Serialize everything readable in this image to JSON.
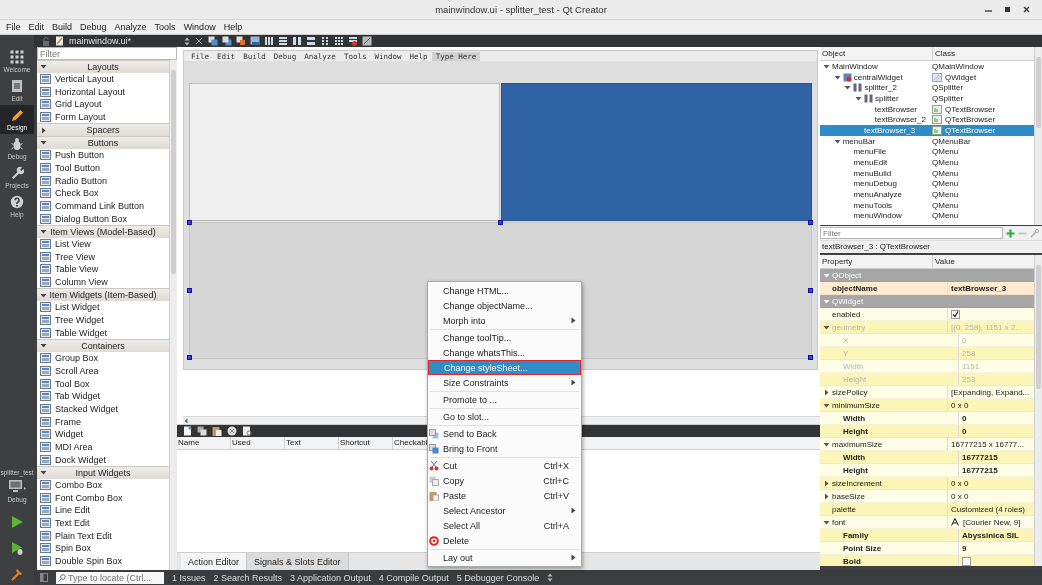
{
  "window": {
    "title": "mainwindow.ui - splitter_test - Qt Creator"
  },
  "menu_bar": [
    "File",
    "Edit",
    "Build",
    "Debug",
    "Analyze",
    "Tools",
    "Window",
    "Help"
  ],
  "mode_bar": {
    "modes": [
      {
        "label": "Welcome",
        "kind": "welcome",
        "selected": false
      },
      {
        "label": "Edit",
        "kind": "edit",
        "selected": false
      },
      {
        "label": "Design",
        "kind": "design",
        "selected": true
      },
      {
        "label": "Debug",
        "kind": "debug",
        "selected": false
      },
      {
        "label": "Projects",
        "kind": "projects",
        "selected": false
      },
      {
        "label": "Help",
        "kind": "help",
        "selected": false
      }
    ],
    "target": {
      "project": "splitter_test",
      "build": "Debug"
    }
  },
  "editor_toolbar": {
    "document": "mainwindow.ui*"
  },
  "widget_box": {
    "filter_placeholder": "Filter",
    "categories": [
      {
        "name": "Layouts",
        "expanded": true,
        "items": [
          "Vertical Layout",
          "Horizontal Layout",
          "Grid Layout",
          "Form Layout"
        ]
      },
      {
        "name": "Spacers",
        "expanded": false
      },
      {
        "name": "Buttons",
        "expanded": true,
        "items": [
          "Push Button",
          "Tool Button",
          "Radio Button",
          "Check Box",
          "Command Link Button",
          "Dialog Button Box"
        ]
      },
      {
        "name": "Item Views (Model-Based)",
        "expanded": true,
        "items": [
          "List View",
          "Tree View",
          "Table View",
          "Column View"
        ]
      },
      {
        "name": "Item Widgets (Item-Based)",
        "expanded": true,
        "items": [
          "List Widget",
          "Tree Widget",
          "Table Widget"
        ]
      },
      {
        "name": "Containers",
        "expanded": true,
        "items": [
          "Group Box",
          "Scroll Area",
          "Tool Box",
          "Tab Widget",
          "Stacked Widget",
          "Frame",
          "Widget",
          "MDI Area",
          "Dock Widget"
        ]
      },
      {
        "name": "Input Widgets",
        "expanded": true,
        "items": [
          "Combo Box",
          "Font Combo Box",
          "Line Edit",
          "Text Edit",
          "Plain Text Edit",
          "Spin Box",
          "Double Spin Box"
        ]
      }
    ]
  },
  "form": {
    "menu": [
      "File",
      "Edit",
      "Build",
      "Debug",
      "Analyze",
      "Tools",
      "Window",
      "Help"
    ],
    "add_menu_hint": "Type Here"
  },
  "action_editor": {
    "columns": [
      "Name",
      "Used",
      "Text",
      "Shortcut",
      "Checkabl"
    ],
    "tabs": [
      {
        "label": "Action Editor",
        "selected": true
      },
      {
        "label": "Signals & Slots Editor",
        "selected": false
      }
    ]
  },
  "object_inspector": {
    "columns": [
      "Object",
      "Class"
    ],
    "tree": [
      {
        "object": "MainWindow",
        "class": "QMainWindow",
        "expanded": true,
        "selected": false,
        "children": [
          {
            "object": "centralWidget",
            "class": "QWidget",
            "kind": "widget",
            "expanded": true,
            "selected": false,
            "children": [
              {
                "object": "splitter_2",
                "class": "QSplitter",
                "kind": "splitter",
                "expanded": true,
                "selected": false,
                "children": [
                  {
                    "object": "splitter",
                    "class": "QSplitter",
                    "kind": "splitter",
                    "expanded": true,
                    "selected": false,
                    "children": [
                      {
                        "object": "textBrowser",
                        "class": "QTextBrowser",
                        "kind": "browser",
                        "selected": false
                      },
                      {
                        "object": "textBrowser_2",
                        "class": "QTextBrowser",
                        "kind": "browser",
                        "selected": false
                      }
                    ]
                  },
                  {
                    "object": "textBrowser_3",
                    "class": "QTextBrowser",
                    "kind": "browser",
                    "selected": true
                  }
                ]
              }
            ]
          },
          {
            "object": "menuBar",
            "class": "QMenuBar",
            "expanded": true,
            "selected": false,
            "children": [
              {
                "object": "menuFile",
                "class": "QMenu",
                "selected": false
              },
              {
                "object": "menuEdit",
                "class": "QMenu",
                "selected": false
              },
              {
                "object": "menuBuild",
                "class": "QMenu",
                "selected": false
              },
              {
                "object": "menuDebug",
                "class": "QMenu",
                "selected": false
              },
              {
                "object": "menuAnalyze",
                "class": "QMenu",
                "selected": false
              },
              {
                "object": "menuTools",
                "class": "QMenu",
                "selected": false
              },
              {
                "object": "menuWindow",
                "class": "QMenu",
                "selected": false
              }
            ]
          }
        ]
      }
    ]
  },
  "property_editor": {
    "filter_placeholder": "Filter",
    "caption": "textBrowser_3 : QTextBrowser",
    "columns": [
      "Property",
      "Value"
    ],
    "groups": [
      {
        "name": "QObject",
        "expanded": true,
        "color": "#feeacf",
        "properties": [
          {
            "name": "objectName",
            "kind": "text",
            "value": "textBrowser_3",
            "modified": true,
            "disabled": false
          }
        ]
      },
      {
        "name": "QWidget",
        "expanded": true,
        "color": "#fffde6",
        "properties": [
          {
            "name": "enabled",
            "kind": "check",
            "checked": true,
            "modified": false,
            "disabled": false
          },
          {
            "name": "geometry",
            "kind": "text",
            "value": "[(0, 258), 1151 x 2...",
            "modified": false,
            "disabled": true,
            "expanded": true,
            "children": [
              {
                "name": "X",
                "kind": "text",
                "value": "0",
                "modified": false,
                "disabled": true
              },
              {
                "name": "Y",
                "kind": "text",
                "value": "258",
                "modified": false,
                "disabled": true
              },
              {
                "name": "Width",
                "kind": "text",
                "value": "1151",
                "modified": false,
                "disabled": true
              },
              {
                "name": "Height",
                "kind": "text",
                "value": "253",
                "modified": false,
                "disabled": true
              }
            ]
          },
          {
            "name": "sizePolicy",
            "kind": "text",
            "value": "[Expanding, Expand...",
            "modified": false,
            "disabled": false,
            "expanded": false
          },
          {
            "name": "minimumSize",
            "kind": "text",
            "value": "0 x 0",
            "modified": false,
            "disabled": false,
            "expanded": true,
            "children": [
              {
                "name": "Width",
                "kind": "text",
                "value": "0",
                "modified": true,
                "disabled": false
              },
              {
                "name": "Height",
                "kind": "text",
                "value": "0",
                "modified": true,
                "disabled": false
              }
            ]
          },
          {
            "name": "maximumSize",
            "kind": "text",
            "value": "16777215 x 16777...",
            "modified": false,
            "disabled": false,
            "expanded": true,
            "children": [
              {
                "name": "Width",
                "kind": "text",
                "value": "16777215",
                "modified": true,
                "disabled": false
              },
              {
                "name": "Height",
                "kind": "text",
                "value": "16777215",
                "modified": true,
                "disabled": false
              }
            ]
          },
          {
            "name": "sizeIncrement",
            "kind": "text",
            "value": "0 x 0",
            "modified": false,
            "disabled": false,
            "expanded": false
          },
          {
            "name": "baseSize",
            "kind": "text",
            "value": "0 x 0",
            "modified": false,
            "disabled": false,
            "expanded": false
          },
          {
            "name": "palette",
            "kind": "text",
            "value": "Customized (4 roles)",
            "modified": false,
            "disabled": false
          },
          {
            "name": "font",
            "kind": "font",
            "value": "[Courier New, 9]",
            "modified": false,
            "disabled": false,
            "expanded": true,
            "children": [
              {
                "name": "Family",
                "kind": "text",
                "value": "Abyssinica SIL",
                "modified": true,
                "disabled": false
              },
              {
                "name": "Point Size",
                "kind": "text",
                "value": "9",
                "modified": true,
                "disabled": false
              },
              {
                "name": "Bold",
                "kind": "check",
                "checked": false,
                "modified": true,
                "disabled": false
              }
            ]
          }
        ]
      }
    ]
  },
  "context_menu": {
    "items": [
      {
        "label": "Change HTML...",
        "kind": "plain",
        "selected": false
      },
      {
        "label": "Change objectName...",
        "kind": "plain",
        "selected": false
      },
      {
        "label": "Morph into",
        "kind": "submenu",
        "selected": false
      },
      {
        "kind": "separator"
      },
      {
        "label": "Change toolTip...",
        "kind": "plain",
        "selected": false
      },
      {
        "label": "Change whatsThis...",
        "kind": "plain",
        "selected": false
      },
      {
        "label": "Change styleSheet...",
        "kind": "plain",
        "selected": true
      },
      {
        "label": "Size Constraints",
        "kind": "submenu",
        "selected": false
      },
      {
        "kind": "separator"
      },
      {
        "label": "Promote to ...",
        "kind": "plain",
        "selected": false
      },
      {
        "kind": "separator"
      },
      {
        "label": "Go to slot...",
        "kind": "plain",
        "selected": false
      },
      {
        "kind": "separator"
      },
      {
        "label": "Send to Back",
        "kind": "back",
        "selected": false
      },
      {
        "label": "Bring to Front",
        "kind": "front",
        "selected": false
      },
      {
        "kind": "separator"
      },
      {
        "label": "Cut",
        "kind": "cut",
        "shortcut": "Ctrl+X",
        "selected": false
      },
      {
        "label": "Copy",
        "kind": "copy",
        "shortcut": "Ctrl+C",
        "selected": false
      },
      {
        "label": "Paste",
        "kind": "paste",
        "shortcut": "Ctrl+V",
        "selected": false
      },
      {
        "label": "Select Ancestor",
        "kind": "submenu",
        "selected": false
      },
      {
        "label": "Select All",
        "kind": "plain",
        "shortcut": "Ctrl+A",
        "selected": false
      },
      {
        "label": "Delete",
        "kind": "delete",
        "selected": false
      },
      {
        "kind": "separator"
      },
      {
        "label": "Lay out",
        "kind": "submenu",
        "selected": false
      }
    ]
  },
  "status_bar": {
    "locate_placeholder": "Type to locate (Ctrl...",
    "panes": [
      "1 Issues",
      "2 Search Results",
      "3 Application Output",
      "4 Compile Output",
      "5 Debugger Console"
    ]
  }
}
